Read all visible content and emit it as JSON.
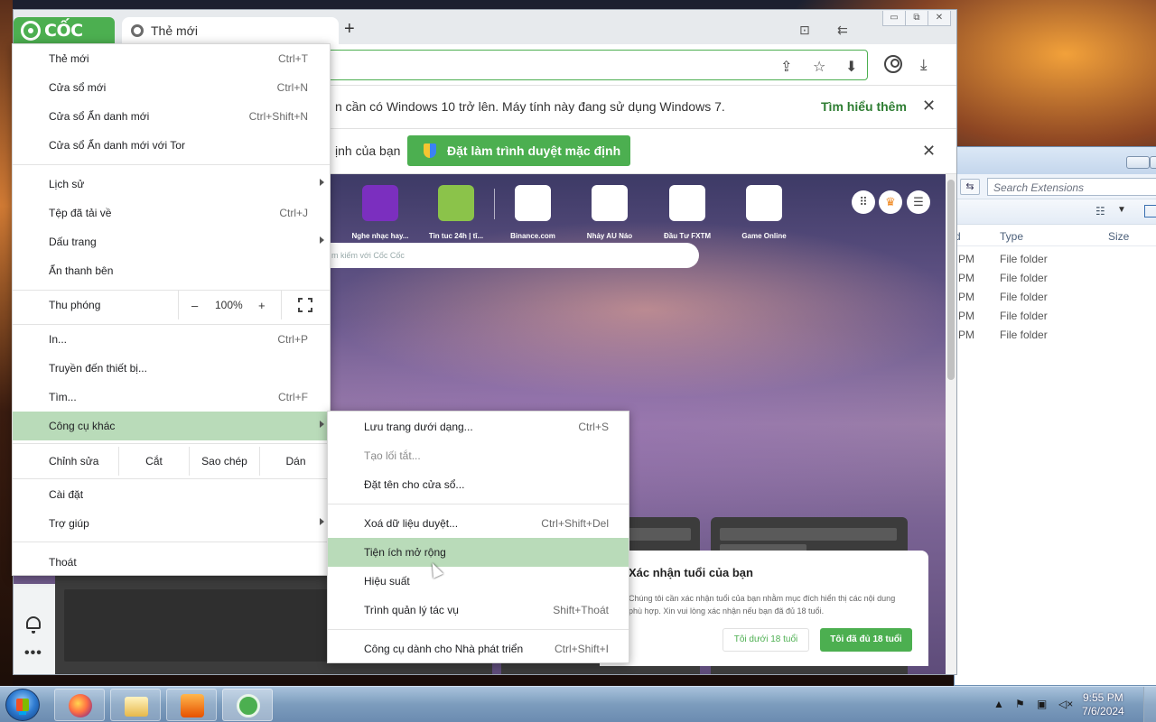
{
  "browser": {
    "brand": "CỐC CỐC",
    "tab_title": "Thẻ mới",
    "new_tab_symbol": "+",
    "caption": {
      "minimize": "▭",
      "restore": "⧉",
      "close": "✕"
    }
  },
  "infobar1": {
    "message": "n cần có Windows 10 trở lên. Máy tính này đang sử dụng Windows 7.",
    "learn_more": "Tìm hiểu thêm"
  },
  "infobar2": {
    "message": "ịnh của bạn",
    "button": "Đặt làm trình duyệt mặc định"
  },
  "speed_dial": [
    {
      "label": "Nghe nhạc hay...",
      "color": "#7b2fbf"
    },
    {
      "label": "Tin tuc 24h | tî...",
      "color": "#8bc34a"
    },
    {
      "label": "Binance.com",
      "color": "#ffffff"
    },
    {
      "label": "Nhảy AU Náo",
      "color": "#ffffff"
    },
    {
      "label": "Đầu Tư FXTM",
      "color": "#ffffff"
    },
    {
      "label": "Game Online",
      "color": "#ffffff"
    }
  ],
  "search_placeholder": "m kiếm với Cốc Cốc",
  "menu": {
    "items": [
      {
        "label": "Thẻ mới",
        "shortcut": "Ctrl+T"
      },
      {
        "label": "Cửa sổ mới",
        "shortcut": "Ctrl+N"
      },
      {
        "label": "Cửa sổ Ẩn danh mới",
        "shortcut": "Ctrl+Shift+N"
      },
      {
        "label": "Cửa sổ Ẩn danh mới với Tor",
        "shortcut": ""
      },
      {
        "label": "Lịch sử",
        "shortcut": ""
      },
      {
        "label": "Tệp đã tải về",
        "shortcut": "Ctrl+J"
      },
      {
        "label": "Dấu trang",
        "shortcut": ""
      },
      {
        "label": "Ẩn thanh bên",
        "shortcut": ""
      },
      {
        "label": "In...",
        "shortcut": "Ctrl+P"
      },
      {
        "label": "Truyền đến thiết bị...",
        "shortcut": ""
      },
      {
        "label": "Tìm...",
        "shortcut": "Ctrl+F"
      },
      {
        "label": "Công cụ khác",
        "shortcut": ""
      },
      {
        "label": "Cài đặt",
        "shortcut": ""
      },
      {
        "label": "Trợ giúp",
        "shortcut": ""
      },
      {
        "label": "Thoát",
        "shortcut": ""
      }
    ],
    "zoom": {
      "label": "Thu phóng",
      "minus": "–",
      "value": "100%",
      "plus": "+"
    },
    "edit": {
      "label": "Chỉnh sửa",
      "cut": "Cắt",
      "copy": "Sao chép",
      "paste": "Dán"
    }
  },
  "submenu": {
    "items": [
      {
        "label": "Lưu trang dưới dạng...",
        "shortcut": "Ctrl+S"
      },
      {
        "label": "Tạo lối tắt...",
        "shortcut": ""
      },
      {
        "label": "Đặt tên cho cửa sổ...",
        "shortcut": ""
      },
      {
        "label": "Xoá dữ liệu duyệt...",
        "shortcut": "Ctrl+Shift+Del"
      },
      {
        "label": "Tiện ích mở rộng",
        "shortcut": ""
      },
      {
        "label": "Hiệu suất",
        "shortcut": ""
      },
      {
        "label": "Trình quản lý tác vụ",
        "shortcut": "Shift+Thoát"
      },
      {
        "label": "Công cụ dành cho Nhà phát triển",
        "shortcut": "Ctrl+Shift+I"
      }
    ]
  },
  "age_dialog": {
    "title": "Xác nhận tuổi của bạn",
    "description": "Chúng tôi cần xác nhận tuổi của bạn nhằm mục đích hiển thị các nội dung phù hợp. Xin vui lòng xác nhận nếu bạn đã đủ 18 tuổi.",
    "under_button": "Tôi dưới 18 tuổi",
    "over_button": "Tôi đã đủ 18 tuổi"
  },
  "explorer": {
    "search_placeholder": "Search Extensions",
    "columns": {
      "col_d": "d",
      "type": "Type",
      "size": "Size"
    },
    "rows": [
      {
        "time": "PM",
        "type": "File folder"
      },
      {
        "time": "PM",
        "type": "File folder"
      },
      {
        "time": "PM",
        "type": "File folder"
      },
      {
        "time": "PM",
        "type": "File folder"
      },
      {
        "time": "PM",
        "type": "File folder"
      }
    ]
  },
  "taskbar": {
    "time": "9:55 PM",
    "date": "7/6/2024"
  }
}
